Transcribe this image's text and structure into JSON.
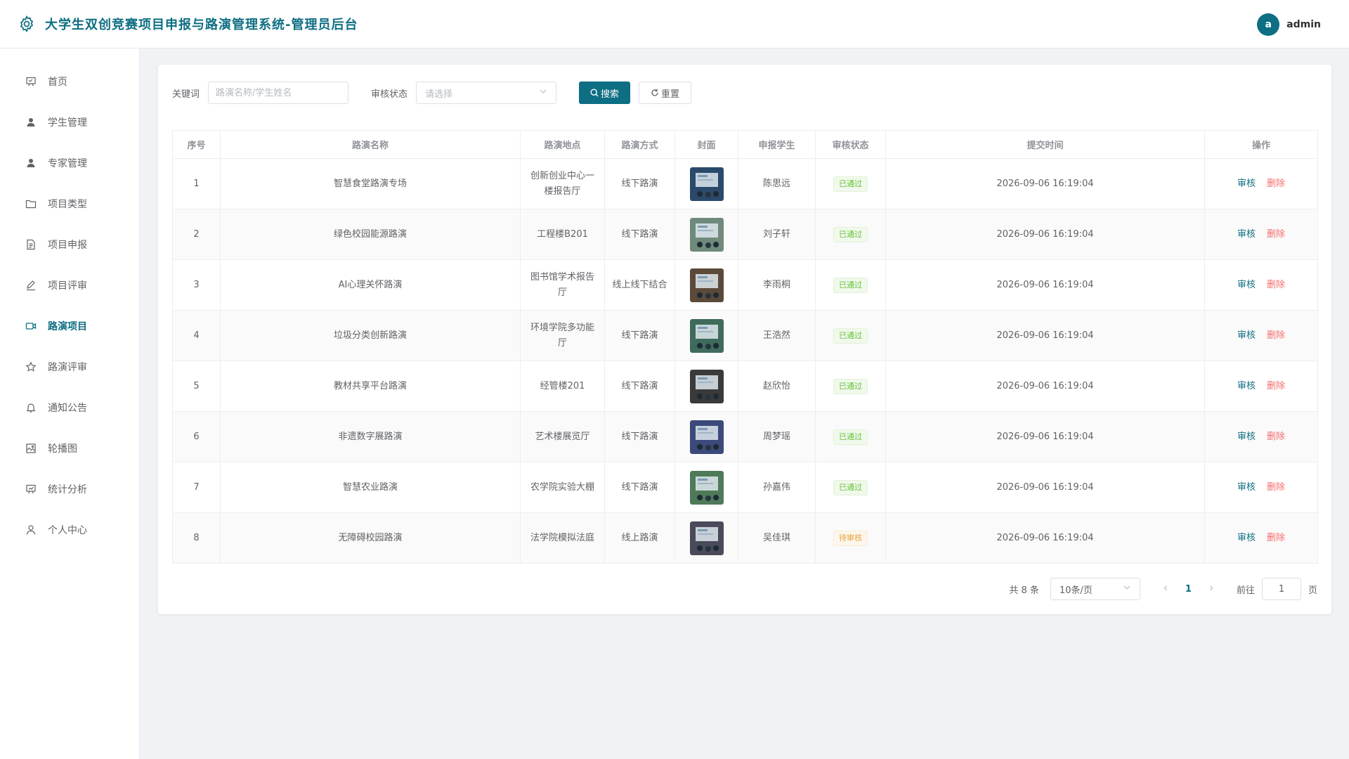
{
  "header": {
    "title": "大学生双创竞赛项目申报与路演管理系统-管理员后台",
    "avatar_letter": "a",
    "username": "admin",
    "accent": "#0e6e83"
  },
  "sidebar": {
    "items": [
      {
        "label": "首页",
        "icon": "dashboard-icon",
        "active": false
      },
      {
        "label": "学生管理",
        "icon": "user-icon",
        "active": false
      },
      {
        "label": "专家管理",
        "icon": "user-icon",
        "active": false
      },
      {
        "label": "项目类型",
        "icon": "folder-icon",
        "active": false
      },
      {
        "label": "项目申报",
        "icon": "document-icon",
        "active": false
      },
      {
        "label": "项目评审",
        "icon": "edit-icon",
        "active": false
      },
      {
        "label": "路演项目",
        "icon": "video-camera-icon",
        "active": true
      },
      {
        "label": "路演评审",
        "icon": "star-icon",
        "active": false
      },
      {
        "label": "通知公告",
        "icon": "bell-icon",
        "active": false
      },
      {
        "label": "轮播图",
        "icon": "picture-icon",
        "active": false
      },
      {
        "label": "统计分析",
        "icon": "chart-icon",
        "active": false
      },
      {
        "label": "个人中心",
        "icon": "person-icon",
        "active": false
      }
    ]
  },
  "filters": {
    "keyword_label": "关键词",
    "keyword_placeholder": "路演名称/学生姓名",
    "status_label": "审核状态",
    "status_placeholder": "请选择",
    "search_label": "搜索",
    "reset_label": "重置"
  },
  "table": {
    "columns": [
      "序号",
      "路演名称",
      "路演地点",
      "路演方式",
      "封面",
      "申报学生",
      "审核状态",
      "提交时间",
      "操作"
    ],
    "review_label": "审核",
    "delete_label": "删除",
    "rows": [
      {
        "no": "1",
        "name": "智慧食堂路演专场",
        "location": "创新创业中心一楼报告厅",
        "mode": "线下路演",
        "student": "陈思远",
        "status": "已通过",
        "status_type": "ok",
        "time": "2026-09-06 16:19:04",
        "cover_color": "#2b4a6b"
      },
      {
        "no": "2",
        "name": "绿色校园能源路演",
        "location": "工程楼B201",
        "mode": "线下路演",
        "student": "刘子轩",
        "status": "已通过",
        "status_type": "ok",
        "time": "2026-09-06 16:19:04",
        "cover_color": "#6f8a7a"
      },
      {
        "no": "3",
        "name": "AI心理关怀路演",
        "location": "图书馆学术报告厅",
        "mode": "线上线下结合",
        "student": "李雨桐",
        "status": "已通过",
        "status_type": "ok",
        "time": "2026-09-06 16:19:04",
        "cover_color": "#5b4a3a"
      },
      {
        "no": "4",
        "name": "垃圾分类创新路演",
        "location": "环境学院多功能厅",
        "mode": "线下路演",
        "student": "王浩然",
        "status": "已通过",
        "status_type": "ok",
        "time": "2026-09-06 16:19:04",
        "cover_color": "#3f6b5c"
      },
      {
        "no": "5",
        "name": "教材共享平台路演",
        "location": "经管楼201",
        "mode": "线下路演",
        "student": "赵欣怡",
        "status": "已通过",
        "status_type": "ok",
        "time": "2026-09-06 16:19:04",
        "cover_color": "#3a3a3a"
      },
      {
        "no": "6",
        "name": "非遗数字展路演",
        "location": "艺术楼展览厅",
        "mode": "线下路演",
        "student": "周梦瑶",
        "status": "已通过",
        "status_type": "ok",
        "time": "2026-09-06 16:19:04",
        "cover_color": "#3b4a7a"
      },
      {
        "no": "7",
        "name": "智慧农业路演",
        "location": "农学院实验大棚",
        "mode": "线下路演",
        "student": "孙嘉伟",
        "status": "已通过",
        "status_type": "ok",
        "time": "2026-09-06 16:19:04",
        "cover_color": "#4f7a5a"
      },
      {
        "no": "8",
        "name": "无障碍校园路演",
        "location": "法学院模拟法庭",
        "mode": "线上路演",
        "student": "吴佳琪",
        "status": "待审核",
        "status_type": "pending",
        "time": "2026-09-06 16:19:04",
        "cover_color": "#4a4a5a"
      }
    ]
  },
  "pagination": {
    "total_text": "共 8 条",
    "page_size": "10条/页",
    "current_page": "1",
    "goto_label": "前往",
    "goto_value": "1",
    "page_suffix": "页"
  }
}
